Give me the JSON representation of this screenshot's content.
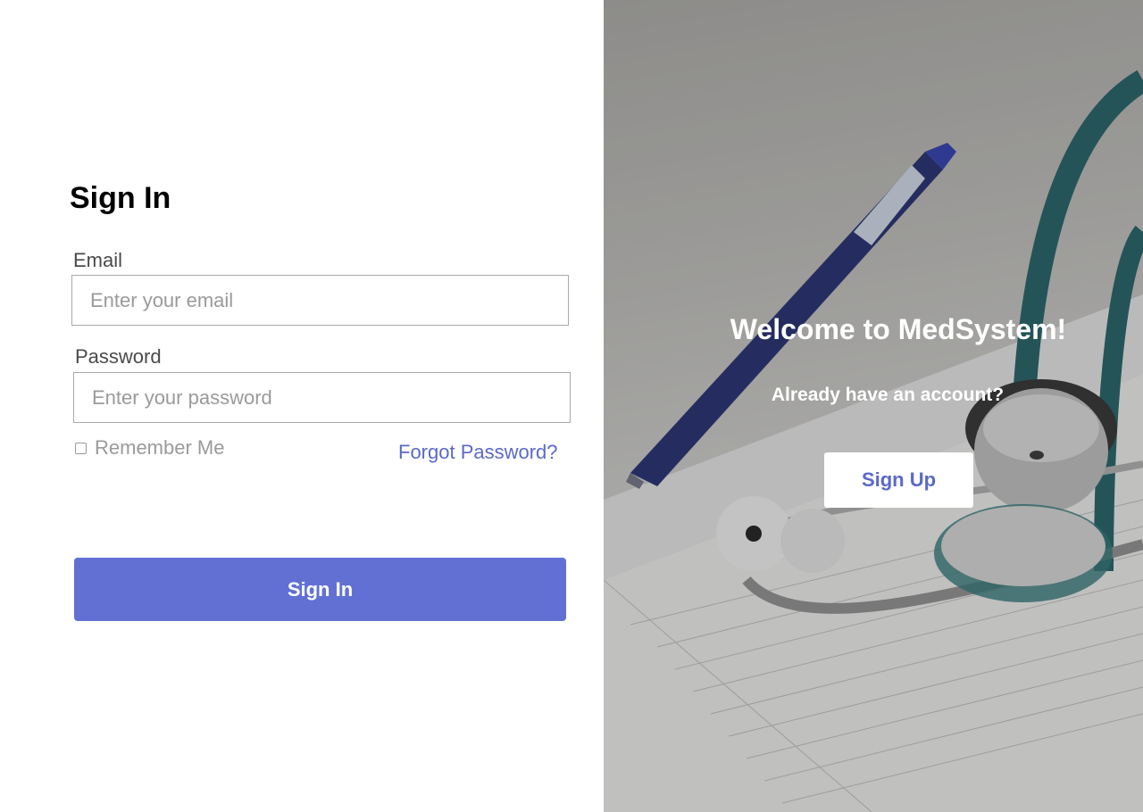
{
  "signin_form": {
    "title": "Sign In",
    "email": {
      "label": "Email",
      "value": "",
      "placeholder": "Enter your email"
    },
    "password": {
      "label": "Password",
      "value": "",
      "placeholder": "Enter your password"
    },
    "remember_me": {
      "label": "Remember Me",
      "checked": false
    },
    "forgot_password_label": "Forgot Password?",
    "submit_label": "Sign In"
  },
  "welcome_panel": {
    "heading": "Welcome to MedSystem!",
    "subtext": "Already have an account?",
    "signup_label": "Sign Up",
    "background_image": "stethoscope-and-pen-on-paper"
  },
  "colors": {
    "primary": "#6270d4",
    "link": "#5a69c9",
    "label": "#4a4a4a",
    "placeholder": "#9a9a9a"
  }
}
